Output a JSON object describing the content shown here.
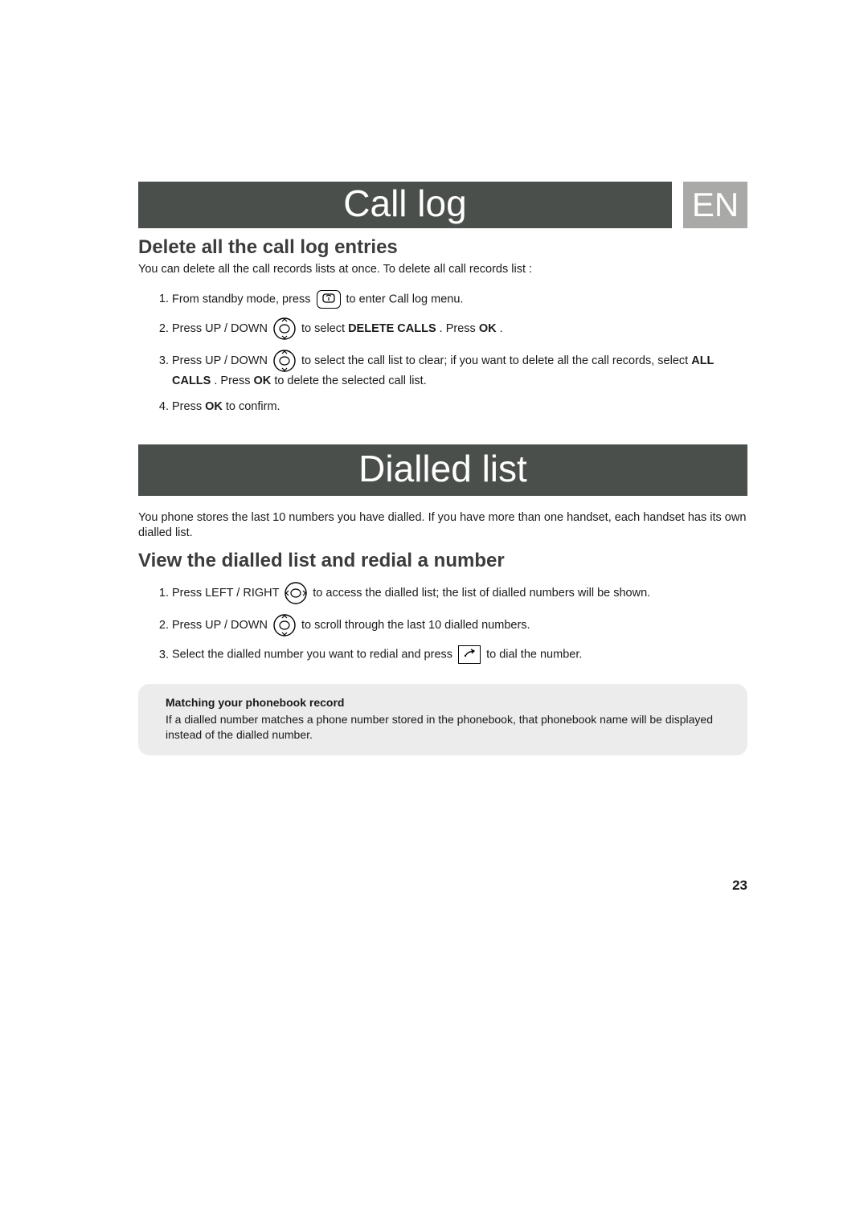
{
  "header": {
    "title": "Call log",
    "lang": "EN"
  },
  "section1": {
    "heading": "Delete all the call log entries",
    "intro": "You can delete all the call records lists at once. To delete all call records list :",
    "steps": {
      "s1a": "From standby mode, press ",
      "s1b": " to enter Call log menu.",
      "s2a": "Press UP / DOWN ",
      "s2b": " to select ",
      "s2bold": "DELETE CALLS",
      "s2c": ". Press ",
      "s2ok": "OK",
      "s2d": ".",
      "s3a": "Press UP / DOWN ",
      "s3b": " to select the call list to clear; if you want to delete all the call records, select ",
      "s3bold": "ALL CALLS",
      "s3c": ". Press ",
      "s3ok": "OK",
      "s3d": " to delete the selected call list.",
      "s4a": "Press ",
      "s4ok": "OK",
      "s4b": " to confirm."
    }
  },
  "section2": {
    "bar": "Dialled list",
    "intro": "You phone stores the last 10 numbers you have dialled. If you have more than one handset, each handset has its own dialled list.",
    "heading": "View the dialled list and redial a number",
    "steps": {
      "s1a": "Press LEFT / RIGHT ",
      "s1b": " to access the dialled list; the list of dialled numbers will be shown.",
      "s2a": "Press UP / DOWN ",
      "s2b": " to scroll through the last 10 dialled numbers.",
      "s3a": "Select the dialled number you want to redial and press ",
      "s3b": " to dial the number."
    },
    "note": {
      "title": "Matching your phonebook record",
      "body": "If a dialled number matches a phone number stored in the phonebook, that phonebook name will be displayed instead of the dialled number."
    }
  },
  "page_number": "23"
}
